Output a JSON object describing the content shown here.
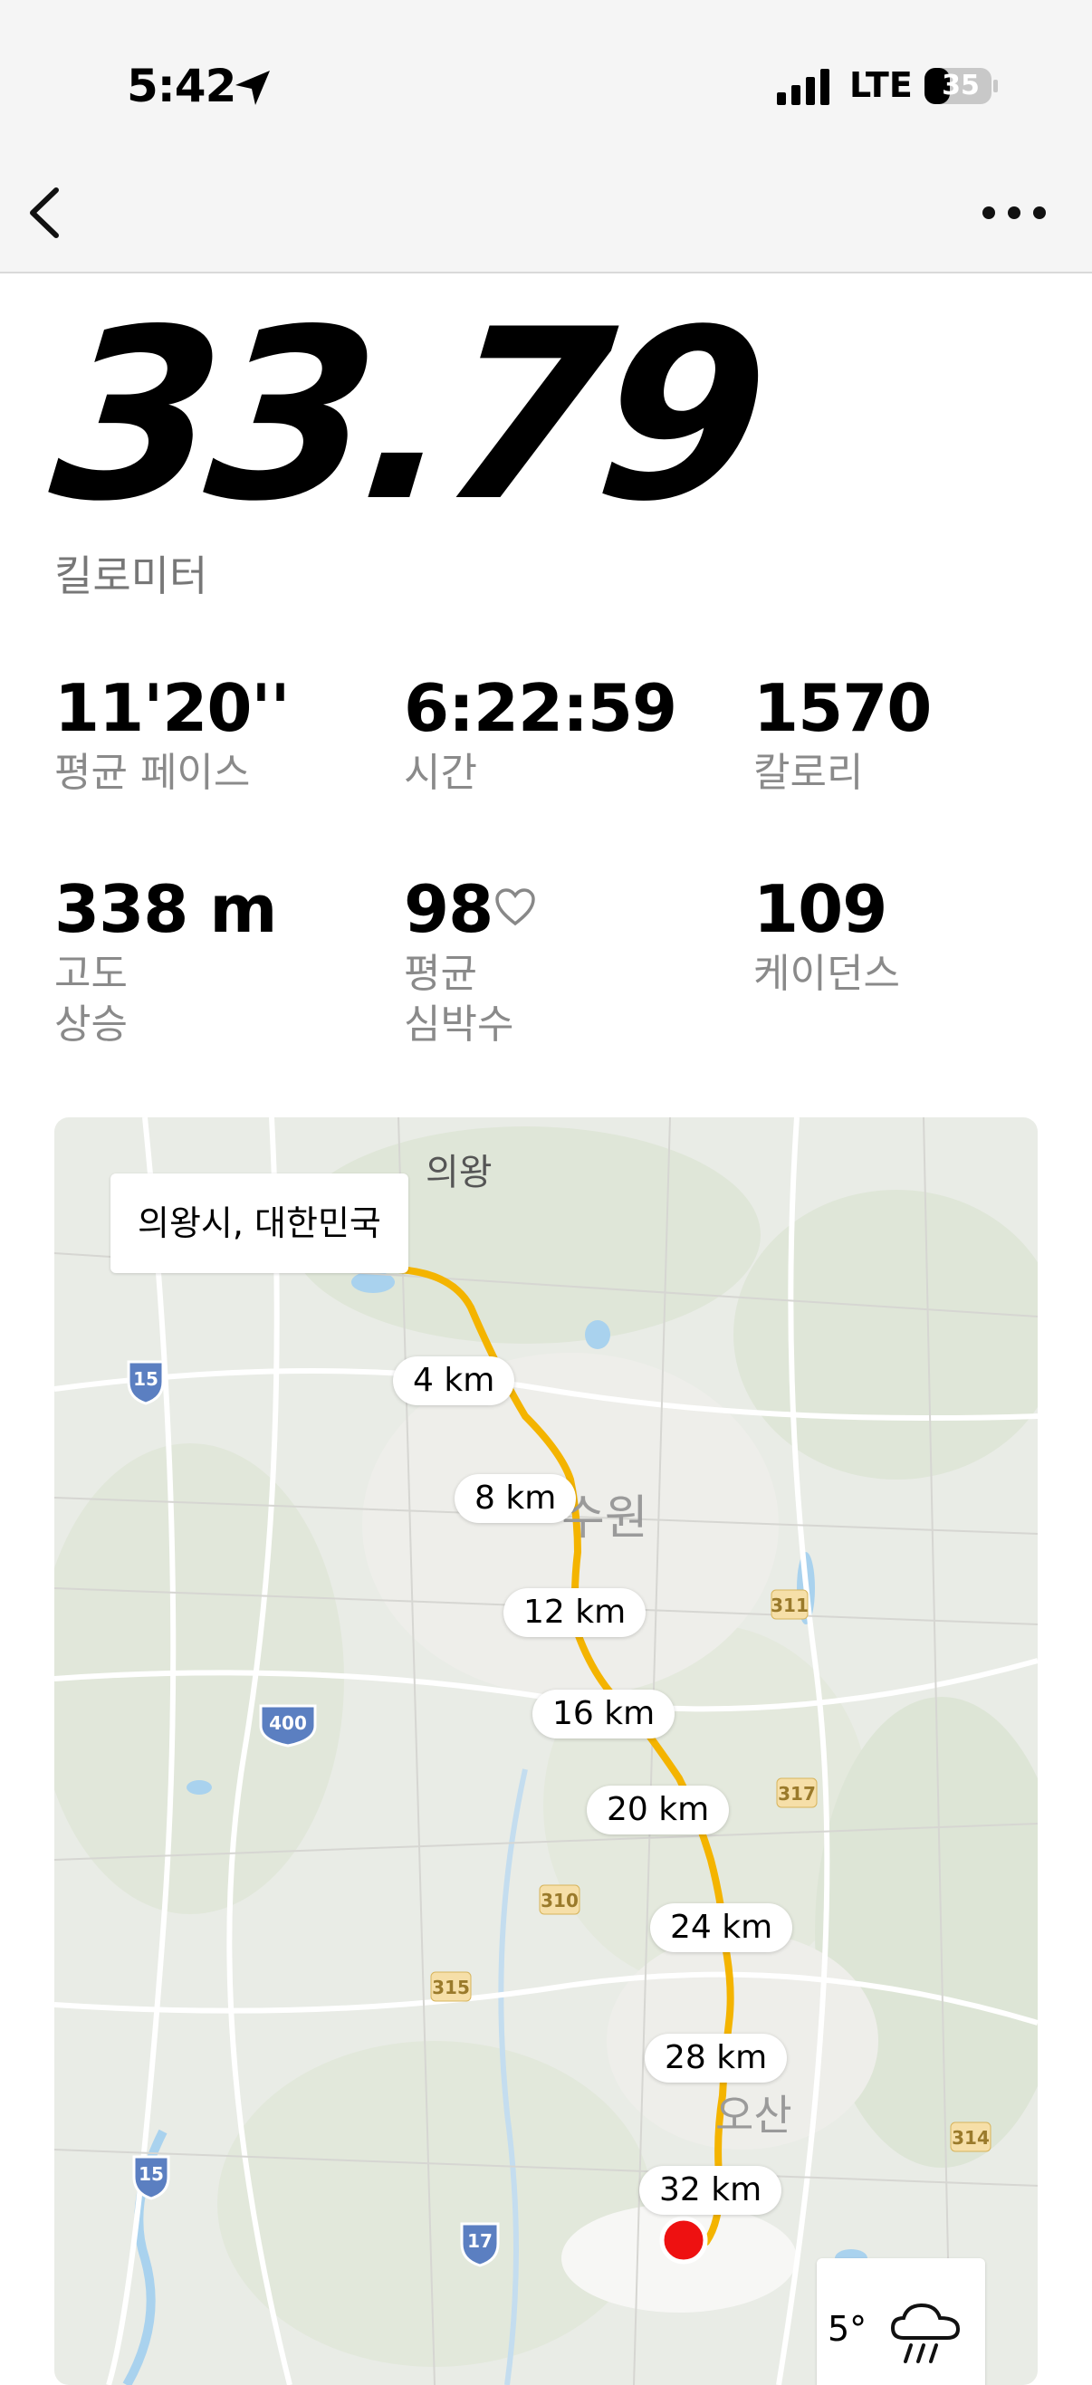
{
  "status": {
    "time": "5:42",
    "network": "LTE",
    "battery": "35"
  },
  "activity": {
    "distance": "33.79",
    "unit": "킬로미터"
  },
  "stats": [
    {
      "value": "11'20''",
      "label": "평균 페이스"
    },
    {
      "value": "6:22:59",
      "label": "시간"
    },
    {
      "value": "1570",
      "label": "칼로리"
    },
    {
      "value": "338 m",
      "label1": "고도",
      "label2": "상승"
    },
    {
      "value": "98",
      "label1": "평균",
      "label2": "심박수"
    },
    {
      "value": "109",
      "label": "케이던스"
    }
  ],
  "map": {
    "location": "의왕시, 대한민국",
    "city_labels": [
      "의왕",
      "수원",
      "오산"
    ],
    "route_color": "#f4b400",
    "start_color": "#52c41a",
    "end_color": "#ee1111",
    "km_markers": [
      "4 km",
      "8 km",
      "12 km",
      "16 km",
      "20 km",
      "24 km",
      "28 km",
      "32 km"
    ],
    "highway_labels": [
      "15",
      "400",
      "311",
      "317",
      "310",
      "315",
      "314",
      "15",
      "17"
    ],
    "weather": {
      "temp": "5°",
      "icon": "rain-icon"
    }
  }
}
